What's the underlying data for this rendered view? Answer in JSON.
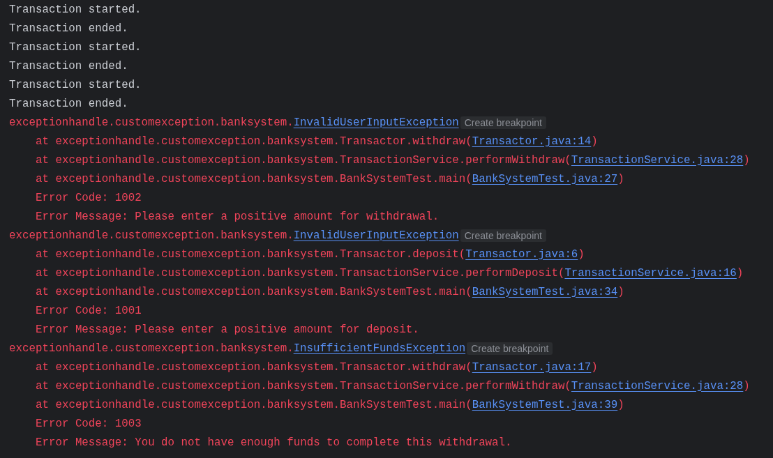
{
  "console": {
    "lines": [
      {
        "kind": "output",
        "text": "Transaction started."
      },
      {
        "kind": "output",
        "text": "Transaction ended."
      },
      {
        "kind": "output",
        "text": "Transaction started."
      },
      {
        "kind": "output",
        "text": "Transaction ended."
      },
      {
        "kind": "output",
        "text": "Transaction started."
      },
      {
        "kind": "output",
        "text": "Transaction ended."
      },
      {
        "kind": "exception",
        "text": "exceptionhandle.customexception.banksystem.",
        "link": "InvalidUserInputException",
        "badge": "Create breakpoint"
      },
      {
        "kind": "frame",
        "text": "at exceptionhandle.customexception.banksystem.Transactor.withdraw(",
        "link": "Transactor.java:14",
        "after": ")"
      },
      {
        "kind": "frame",
        "text": "at exceptionhandle.customexception.banksystem.TransactionService.performWithdraw(",
        "link": "TransactionService.java:28",
        "after": ")"
      },
      {
        "kind": "frame",
        "text": "at exceptionhandle.customexception.banksystem.BankSystemTest.main(",
        "link": "BankSystemTest.java:27",
        "after": ")"
      },
      {
        "kind": "detail",
        "text": "Error Code: 1002"
      },
      {
        "kind": "detail",
        "text": "Error Message: Please enter a positive amount for withdrawal."
      },
      {
        "kind": "exception",
        "text": "exceptionhandle.customexception.banksystem.",
        "link": "InvalidUserInputException",
        "badge": "Create breakpoint"
      },
      {
        "kind": "frame",
        "text": "at exceptionhandle.customexception.banksystem.Transactor.deposit(",
        "link": "Transactor.java:6",
        "after": ")"
      },
      {
        "kind": "frame",
        "text": "at exceptionhandle.customexception.banksystem.TransactionService.performDeposit(",
        "link": "TransactionService.java:16",
        "after": ")"
      },
      {
        "kind": "frame",
        "text": "at exceptionhandle.customexception.banksystem.BankSystemTest.main(",
        "link": "BankSystemTest.java:34",
        "after": ")"
      },
      {
        "kind": "detail",
        "text": "Error Code: 1001"
      },
      {
        "kind": "detail",
        "text": "Error Message: Please enter a positive amount for deposit."
      },
      {
        "kind": "exception",
        "text": "exceptionhandle.customexception.banksystem.",
        "link": "InsufficientFundsException",
        "badge": "Create breakpoint"
      },
      {
        "kind": "frame",
        "text": "at exceptionhandle.customexception.banksystem.Transactor.withdraw(",
        "link": "Transactor.java:17",
        "after": ")"
      },
      {
        "kind": "frame",
        "text": "at exceptionhandle.customexception.banksystem.TransactionService.performWithdraw(",
        "link": "TransactionService.java:28",
        "after": ")"
      },
      {
        "kind": "frame",
        "text": "at exceptionhandle.customexception.banksystem.BankSystemTest.main(",
        "link": "BankSystemTest.java:39",
        "after": ")"
      },
      {
        "kind": "detail",
        "text": "Error Code: 1003"
      },
      {
        "kind": "detail",
        "text": "Error Message: You do not have enough funds to complete this withdrawal."
      }
    ]
  }
}
